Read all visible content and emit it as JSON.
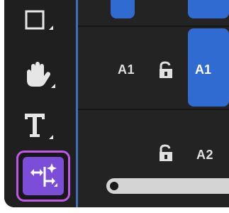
{
  "tools": [
    {
      "icon": "rectangle-tool-icon"
    },
    {
      "icon": "hand-tool-icon"
    },
    {
      "icon": "type-tool-icon"
    },
    {
      "icon": "track-select-tool-icon",
      "active": true
    }
  ],
  "tracks": [
    {
      "source_label": "A1",
      "target_label": "A1",
      "locked": false
    },
    {
      "source_label": "",
      "target_label": "A2",
      "locked": false
    }
  ],
  "colors": {
    "accent": "#2f6bd0",
    "active_tool_border": "#c255ea",
    "active_tool_fill": "#7c4dd9",
    "divider": "#3d6fb8"
  }
}
